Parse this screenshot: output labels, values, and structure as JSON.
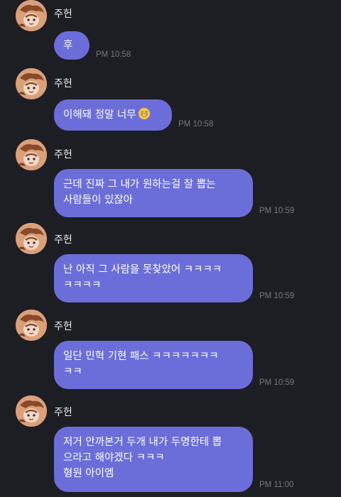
{
  "messages": [
    {
      "sender": "주헌",
      "lines": [
        "후"
      ],
      "time": "PM 10:58"
    },
    {
      "sender": "주헌",
      "lines": [
        "이해돼 정말 너무"
      ],
      "emoji": "grinning-sweat-emoji",
      "time": "PM 10:58"
    },
    {
      "sender": "주헌",
      "lines": [
        "근데 진짜 그 내가 원하는걸 잘 뽑는",
        "사람들이 있잖아"
      ],
      "time": "PM 10:59"
    },
    {
      "sender": "주헌",
      "lines": [
        "난 아직 그 사람을 못찾았어 ㅋㅋㅋㅋ",
        "ㅋㅋㅋㅋ"
      ],
      "time": "PM 10:59"
    },
    {
      "sender": "주헌",
      "lines": [
        "일단 민혁 기현 패스 ㅋㅋㅋㅋㅋㅋㅋ",
        "ㅋㅋ"
      ],
      "time": "PM 10:59"
    },
    {
      "sender": "주헌",
      "lines": [
        "저거 안까본거 두개 내가 두명한테 뽑",
        "으라고 해야겠다 ㅋㅋㅋ",
        "형원 아이엠"
      ],
      "time": "PM 11:00"
    }
  ],
  "colors": {
    "background": "#1d1d24",
    "bubble": "#6b6ed8",
    "time": "#77777f"
  }
}
